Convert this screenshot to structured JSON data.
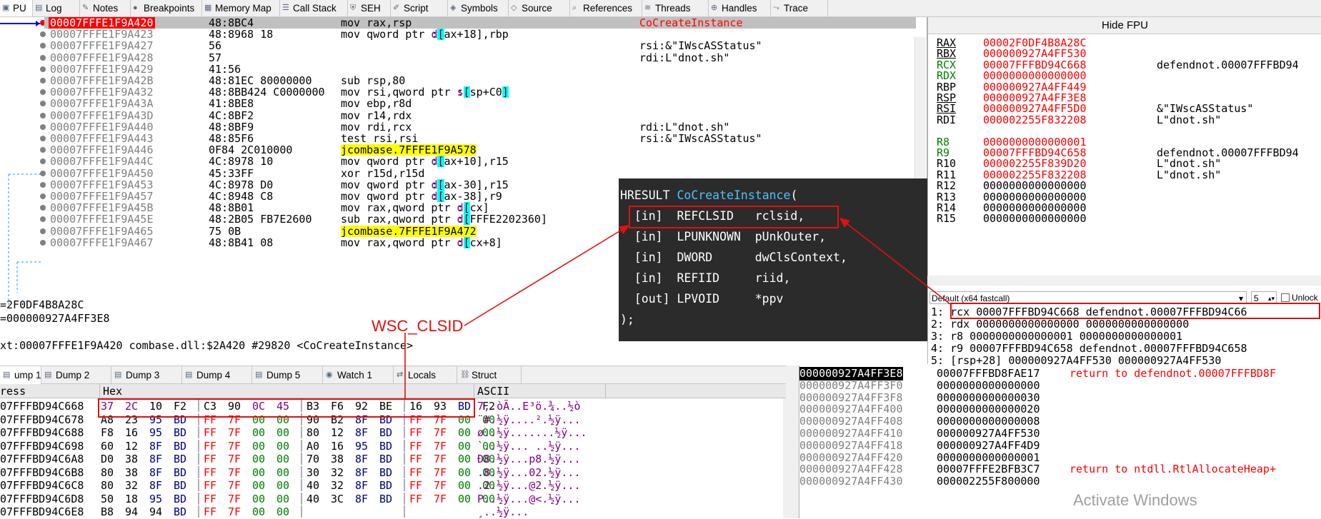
{
  "top_tabs": [
    {
      "label": "PU",
      "icon": "cpu-icon"
    },
    {
      "label": "Log",
      "icon": "log-icon"
    },
    {
      "label": "Notes",
      "icon": "notes-icon"
    },
    {
      "label": "Breakpoints",
      "icon": "breakpoint-icon"
    },
    {
      "label": "Memory Map",
      "icon": "memory-map-icon"
    },
    {
      "label": "Call Stack",
      "icon": "call-stack-icon"
    },
    {
      "label": "SEH",
      "icon": "seh-icon"
    },
    {
      "label": "Script",
      "icon": "script-icon"
    },
    {
      "label": "Symbols",
      "icon": "symbols-icon"
    },
    {
      "label": "Source",
      "icon": "source-icon"
    },
    {
      "label": "References",
      "icon": "references-icon"
    },
    {
      "label": "Threads",
      "icon": "threads-icon"
    },
    {
      "label": "Handles",
      "icon": "handles-icon"
    },
    {
      "label": "Trace",
      "icon": "trace-icon"
    }
  ],
  "disasm": [
    {
      "addr": "00007FFFE1F9A420",
      "bytes": "48:8BC4",
      "ins": "mov rax,rsp",
      "comment": "CoCreateInstance",
      "sel": true
    },
    {
      "addr": "00007FFFE1F9A423",
      "bytes": "48:8968 18",
      "ins": "mov qword ptr ds:[rax+18],rbp",
      "comment": ""
    },
    {
      "addr": "00007FFFE1F9A427",
      "bytes": "56",
      "ins": "push rsi",
      "comment": "rsi:&\"IWscASStatus\""
    },
    {
      "addr": "00007FFFE1F9A428",
      "bytes": "57",
      "ins": "push rdi",
      "comment": "rdi:L\"dnot.sh\""
    },
    {
      "addr": "00007FFFE1F9A429",
      "bytes": "41:56",
      "ins": "push r14",
      "comment": ""
    },
    {
      "addr": "00007FFFE1F9A42B",
      "bytes": "48:81EC 80000000",
      "ins": "sub rsp,80",
      "comment": ""
    },
    {
      "addr": "00007FFFE1F9A432",
      "bytes": "48:8BB424 C0000000",
      "ins": "mov rsi,qword ptr ss:[rsp+C0]",
      "comment": ""
    },
    {
      "addr": "00007FFFE1F9A43A",
      "bytes": "41:8BE8",
      "ins": "mov ebp,r8d",
      "comment": ""
    },
    {
      "addr": "00007FFFE1F9A43D",
      "bytes": "4C:8BF2",
      "ins": "mov r14,rdx",
      "comment": ""
    },
    {
      "addr": "00007FFFE1F9A440",
      "bytes": "48:8BF9",
      "ins": "mov rdi,rcx",
      "comment": "rdi:L\"dnot.sh\""
    },
    {
      "addr": "00007FFFE1F9A443",
      "bytes": "48:85F6",
      "ins": "test rsi,rsi",
      "comment": "rsi:&\"IWscASStatus\""
    },
    {
      "addr": "00007FFFE1F9A446",
      "bytes": "0F84 2C010000",
      "ins": "je combase.7FFFE1F9A578",
      "comment": ""
    },
    {
      "addr": "00007FFFE1F9A44C",
      "bytes": "4C:8978 10",
      "ins": "mov qword ptr ds:[rax+10],r15",
      "comment": ""
    },
    {
      "addr": "00007FFFE1F9A450",
      "bytes": "45:33FF",
      "ins": "xor r15d,r15d",
      "comment": ""
    },
    {
      "addr": "00007FFFE1F9A453",
      "bytes": "4C:8978 D0",
      "ins": "mov qword ptr ds:[rax-30],r15",
      "comment": ""
    },
    {
      "addr": "00007FFFE1F9A457",
      "bytes": "4C:8948 C8",
      "ins": "mov qword ptr ds:[rax-38],r9",
      "comment": ""
    },
    {
      "addr": "00007FFFE1F9A45B",
      "bytes": "48:8B01",
      "ins": "mov rax,qword ptr ds:[rcx]",
      "comment": ""
    },
    {
      "addr": "00007FFFE1F9A45E",
      "bytes": "48:2B05 FB7E2600",
      "ins": "sub rax,qword ptr ds:[7FFFE2202360]",
      "comment": ""
    },
    {
      "addr": "00007FFFE1F9A465",
      "bytes": "75 0B",
      "ins": "jne combase.7FFFE1F9A472",
      "comment": ""
    },
    {
      "addr": "00007FFFE1F9A467",
      "bytes": "48:8B41 08",
      "ins": "mov rax,qword ptr ds:[rcx+8]",
      "comment": ""
    }
  ],
  "info_lines": [
    "=2F0DF4B8A28C",
    "=000000927A4FF3E8",
    "",
    "xt:00007FFFE1F9A420 combase.dll:$2A420 #29820 <CoCreateInstance>"
  ],
  "registers": {
    "hide_fpu": "Hide FPU",
    "rows": [
      {
        "n": "RAX",
        "v": "00002F0DF4B8A28C",
        "c": "",
        "red": true,
        "u": true
      },
      {
        "n": "RBX",
        "v": "000000927A4FF530",
        "c": "",
        "red": true,
        "u": true
      },
      {
        "n": "RCX",
        "v": "00007FFFBD94C668",
        "c": "defendnot.00007FFFBD94",
        "red": true,
        "u": false
      },
      {
        "n": "RDX",
        "v": "0000000000000000",
        "c": "",
        "red": true,
        "u": false
      },
      {
        "n": "RBP",
        "v": "000000927A4FF449",
        "c": "",
        "red": true,
        "u": false
      },
      {
        "n": "RSP",
        "v": "000000927A4FF3E8",
        "c": "",
        "red": true,
        "u": true
      },
      {
        "n": "RSI",
        "v": "000000927A4FF5D0",
        "c": "&\"IWscASStatus\"",
        "red": true,
        "u": true
      },
      {
        "n": "RDI",
        "v": "000002255F832208",
        "c": "L\"dnot.sh\"",
        "red": true,
        "u": false
      },
      {
        "n": "",
        "v": "",
        "c": "",
        "red": false,
        "u": false
      },
      {
        "n": "R8",
        "v": "0000000000000001",
        "c": "",
        "red": true,
        "u": false
      },
      {
        "n": "R9",
        "v": "00007FFFBD94C658",
        "c": "defendnot.00007FFFBD94",
        "red": true,
        "u": false
      },
      {
        "n": "R10",
        "v": "000002255F839D20",
        "c": "L\"dnot.sh\"",
        "red": true,
        "u": false
      },
      {
        "n": "R11",
        "v": "000002255F832208",
        "c": "L\"dnot.sh\"",
        "red": true,
        "u": false
      },
      {
        "n": "R12",
        "v": "0000000000000000",
        "c": "",
        "red": false,
        "u": false
      },
      {
        "n": "R13",
        "v": "0000000000000000",
        "c": "",
        "red": false,
        "u": false
      },
      {
        "n": "R14",
        "v": "0000000000000000",
        "c": "",
        "red": false,
        "u": false
      },
      {
        "n": "R15",
        "v": "0000000000000000",
        "c": "",
        "red": false,
        "u": false
      }
    ]
  },
  "callconv": {
    "selector": "Default (x64 fastcall)",
    "count": "5",
    "unlock": "Unlock",
    "rows": [
      "1: rcx 00007FFFBD94C668 defendnot.00007FFFBD94C66",
      "2: rdx 0000000000000000 0000000000000000",
      "3: r8 0000000000000001 0000000000000001",
      "4: r9 00007FFFBD94C658 defendnot.00007FFFBD94C658",
      "5: [rsp+28] 000000927A4FF530 000000927A4FF530"
    ]
  },
  "dump_tabs": [
    {
      "label": "ump 1",
      "icon": "dump-icon"
    },
    {
      "label": "Dump 2",
      "icon": "dump-icon"
    },
    {
      "label": "Dump 3",
      "icon": "dump-icon"
    },
    {
      "label": "Dump 4",
      "icon": "dump-icon"
    },
    {
      "label": "Dump 5",
      "icon": "dump-icon"
    },
    {
      "label": "Watch 1",
      "icon": "watch-icon"
    },
    {
      "label": "Locals",
      "icon": "locals-icon"
    },
    {
      "label": "Struct",
      "icon": "struct-icon"
    }
  ],
  "dump": {
    "head_address": "ress",
    "head_hex": "Hex",
    "head_ascii": "ASCII",
    "rows": [
      {
        "a": "07FFFBD94C668",
        "h": [
          "37",
          "2C",
          "10",
          "F2",
          "C3",
          "90",
          "0C",
          "45",
          "B3",
          "F6",
          "92",
          "BE",
          "16",
          "93",
          "BD",
          "F2"
        ],
        "s": "7,.òÃ..E³ö.¾..½ò"
      },
      {
        "a": "07FFFBD94C678",
        "h": [
          "A8",
          "23",
          "95",
          "BD",
          "FF",
          "7F",
          "00",
          "00",
          "90",
          "B2",
          "8F",
          "BD",
          "FF",
          "7F",
          "00",
          "00"
        ],
        "s": "¨#.½ÿ....².½ÿ..."
      },
      {
        "a": "07FFFBD94C688",
        "h": [
          "F8",
          "16",
          "95",
          "BD",
          "FF",
          "7F",
          "00",
          "00",
          "80",
          "12",
          "8F",
          "BD",
          "FF",
          "7F",
          "00",
          "00"
        ],
        "s": "ø..½ÿ.......½ÿ..."
      },
      {
        "a": "07FFFBD94C698",
        "h": [
          "60",
          "12",
          "8F",
          "BD",
          "FF",
          "7F",
          "00",
          "00",
          "A0",
          "16",
          "95",
          "BD",
          "FF",
          "7F",
          "00",
          "00"
        ],
        "s": "`..½ÿ... ..½ÿ..."
      },
      {
        "a": "07FFFBD94C6A8",
        "h": [
          "D0",
          "38",
          "8F",
          "BD",
          "FF",
          "7F",
          "00",
          "00",
          "70",
          "38",
          "8F",
          "BD",
          "FF",
          "7F",
          "00",
          "00"
        ],
        "s": "Ð8.½ÿ...p8.½ÿ..."
      },
      {
        "a": "07FFFBD94C6B8",
        "h": [
          "80",
          "38",
          "8F",
          "BD",
          "FF",
          "7F",
          "00",
          "00",
          "30",
          "32",
          "8F",
          "BD",
          "FF",
          "7F",
          "00",
          "00"
        ],
        "s": ".8.½ÿ...02.½ÿ..."
      },
      {
        "a": "07FFFBD94C6C8",
        "h": [
          "80",
          "32",
          "8F",
          "BD",
          "FF",
          "7F",
          "00",
          "00",
          "40",
          "32",
          "8F",
          "BD",
          "FF",
          "7F",
          "00",
          "00"
        ],
        "s": ".2.½ÿ...@2.½ÿ..."
      },
      {
        "a": "07FFFBD94C6D8",
        "h": [
          "50",
          "18",
          "95",
          "BD",
          "FF",
          "7F",
          "00",
          "00",
          "40",
          "3C",
          "8F",
          "BD",
          "FF",
          "7F",
          "00",
          "00"
        ],
        "s": "P..½ÿ...@<.½ÿ..."
      },
      {
        "a": "07FFFBD94C6E8",
        "h": [
          "B8",
          "94",
          "94",
          "BD",
          "FF",
          "7F",
          "00",
          "00",
          "",
          "",
          "",
          "",
          "",
          "",
          "",
          ""
        ],
        "s": "¸..½ÿ..."
      }
    ]
  },
  "stack": [
    {
      "a": "000000927A4FF3E8",
      "v": "00007FFFBD8FAE17",
      "c": "return to defendnot.00007FFFBD8F",
      "top": true
    },
    {
      "a": "000000927A4FF3F0",
      "v": "0000000000000000",
      "c": ""
    },
    {
      "a": "000000927A4FF3F8",
      "v": "0000000000000030",
      "c": ""
    },
    {
      "a": "000000927A4FF400",
      "v": "0000000000000020",
      "c": ""
    },
    {
      "a": "000000927A4FF408",
      "v": "0000000000000008",
      "c": ""
    },
    {
      "a": "000000927A4FF410",
      "v": "000000927A4FF530",
      "c": ""
    },
    {
      "a": "000000927A4FF418",
      "v": "000000927A4FF4D9",
      "c": ""
    },
    {
      "a": "000000927A4FF420",
      "v": "0000000000000001",
      "c": ""
    },
    {
      "a": "000000927A4FF428",
      "v": "00007FFFE2BFB3C7",
      "c": "return to ntdll.RtlAllocateHeap+"
    },
    {
      "a": "000000927A4FF430",
      "v": "000002255F800000",
      "c": ""
    }
  ],
  "tooltip": {
    "lines": [
      {
        "pre": "HRESULT ",
        "fn": "CoCreateInstance",
        "post": "("
      },
      {
        "pre": "  [in]  REFCLSID   rclsid,",
        "fn": "",
        "post": ""
      },
      {
        "pre": "  [in]  LPUNKNOWN  pUnkOuter,",
        "fn": "",
        "post": ""
      },
      {
        "pre": "  [in]  DWORD      dwClsContext,",
        "fn": "",
        "post": ""
      },
      {
        "pre": "  [in]  REFIID     riid,",
        "fn": "",
        "post": ""
      },
      {
        "pre": "  [out] LPVOID     *ppv",
        "fn": "",
        "post": ""
      },
      {
        "pre": ");",
        "fn": "",
        "post": ""
      }
    ]
  },
  "annotation_label": "WSC_CLSID",
  "watermark": "Activate Windows",
  "colors": {
    "accent_red": "#e01010",
    "tooltip_bg": "#2b2b2b",
    "fn_blue": "#4fc1ff"
  }
}
